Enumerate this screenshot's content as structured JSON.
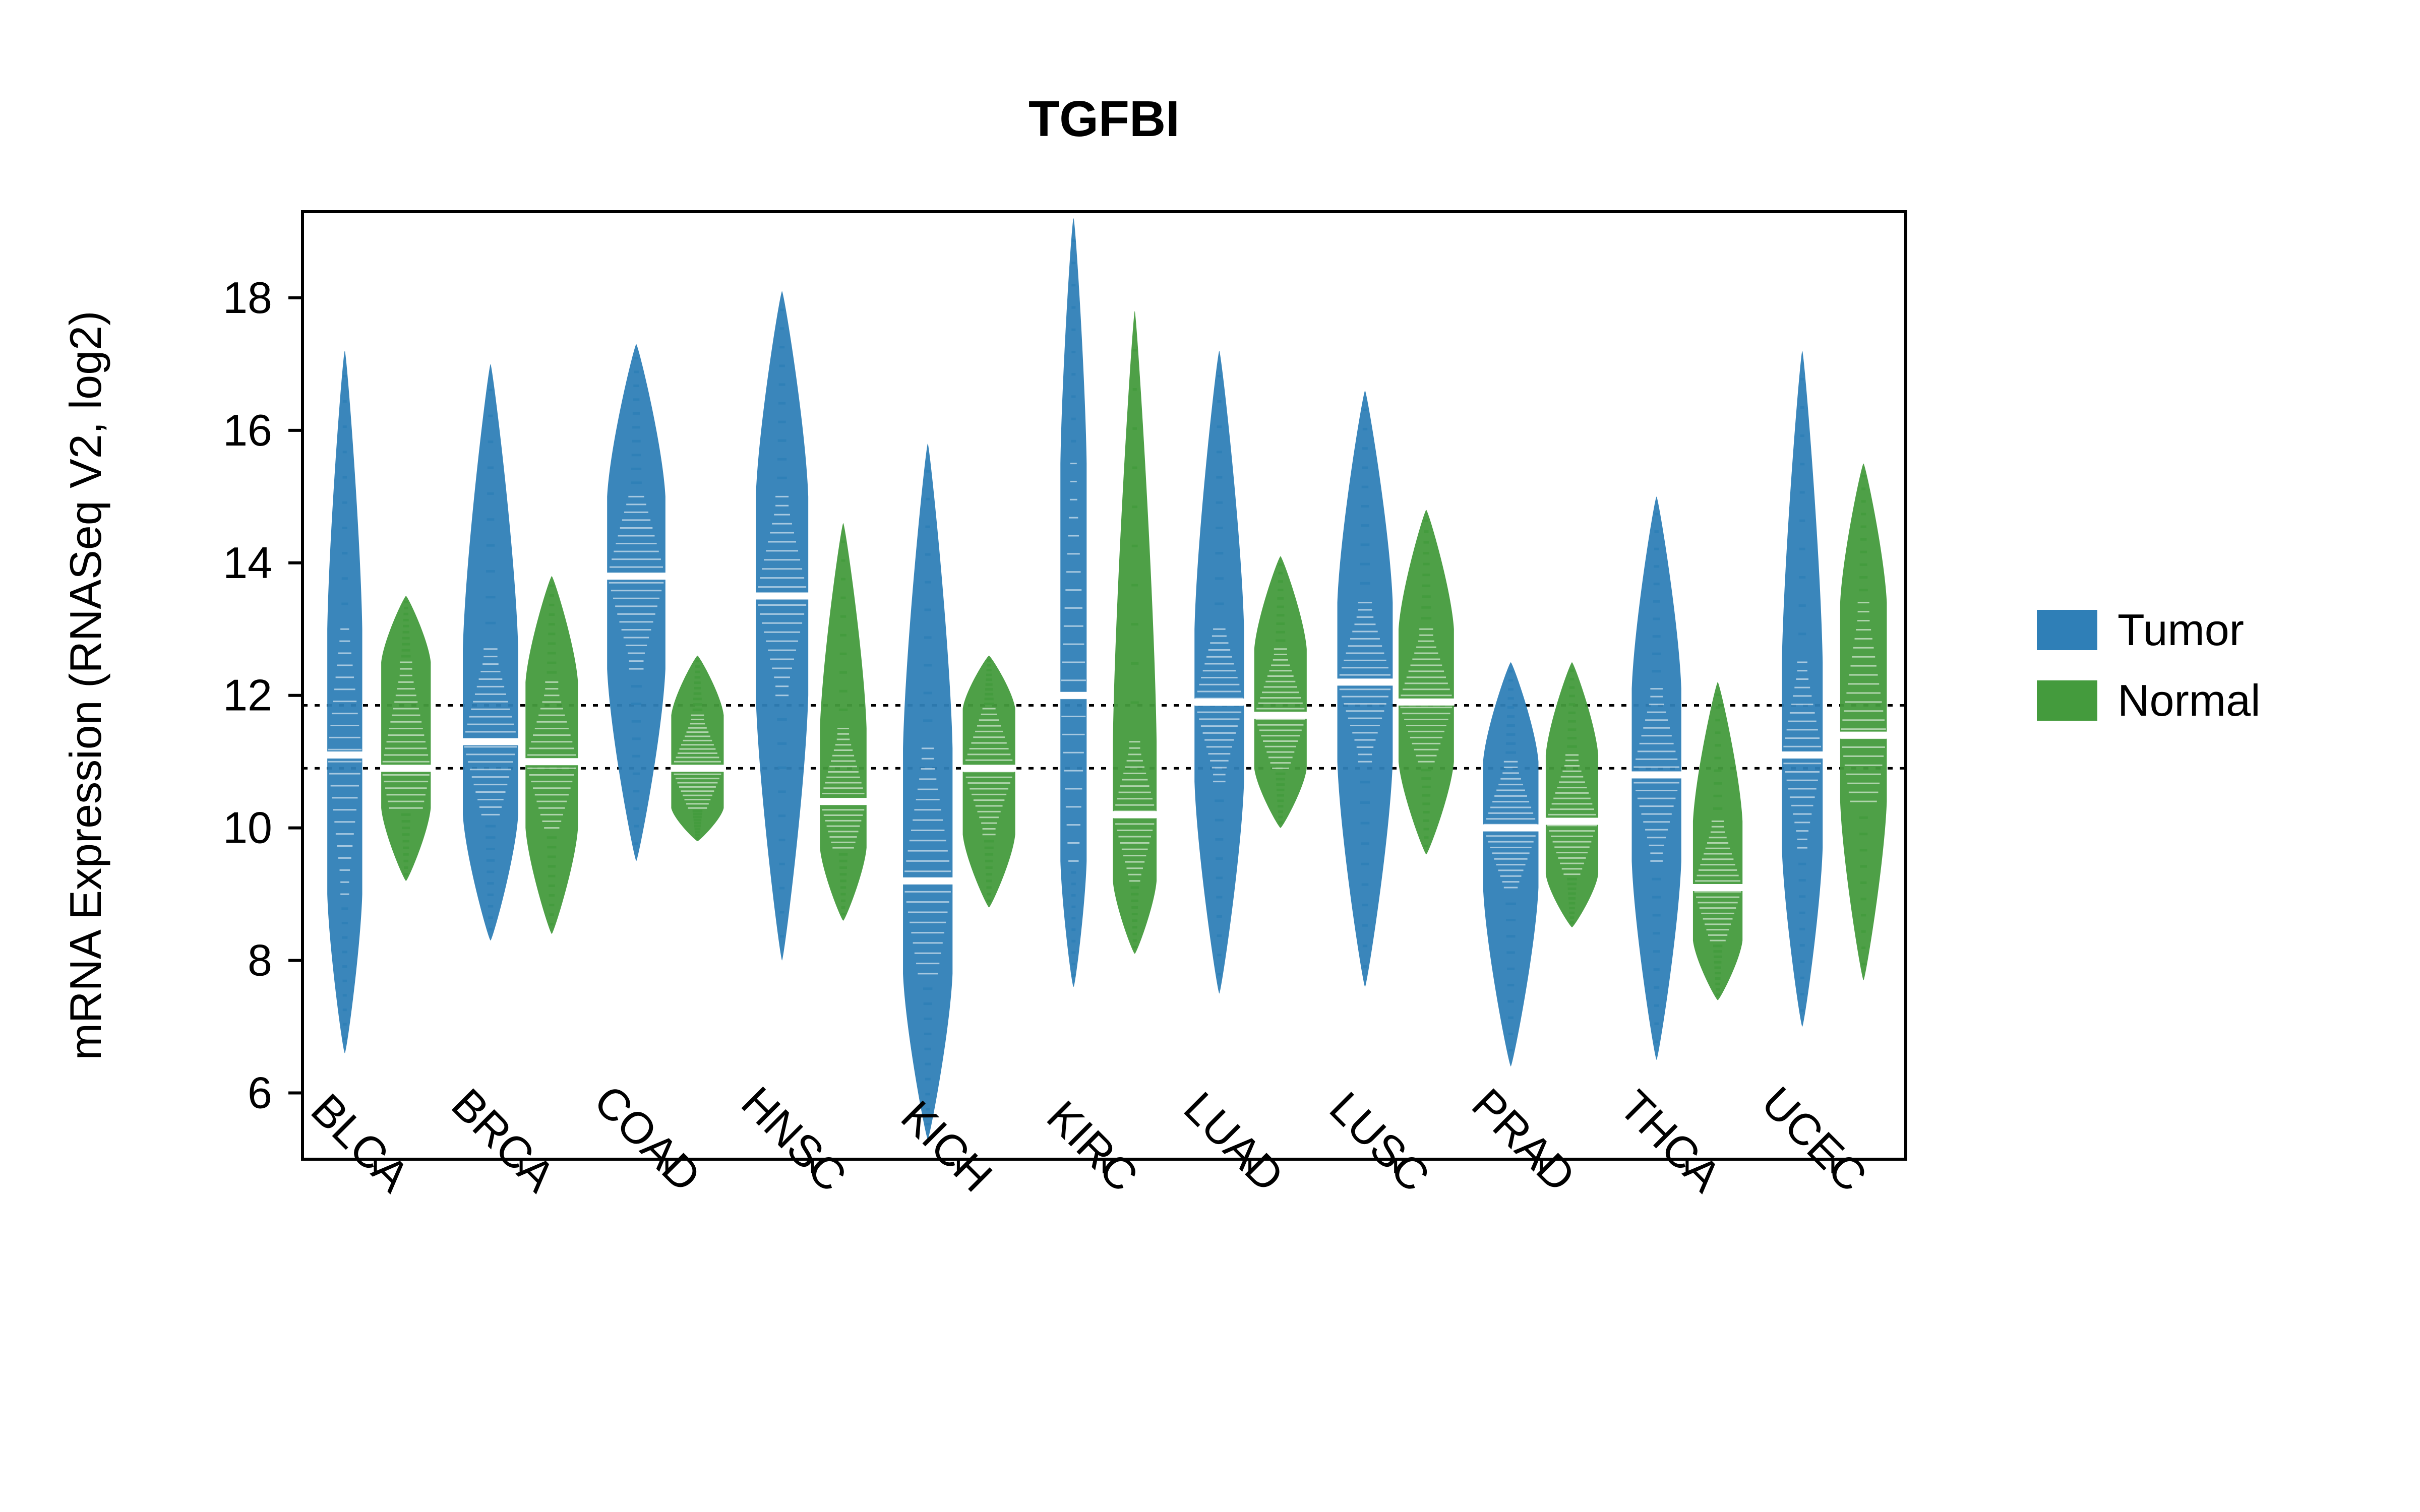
{
  "chart_data": {
    "type": "violin",
    "title": "TGFBI",
    "ylabel": "mRNA Expression (RNASeq V2, log2)",
    "xlabel": "",
    "ylim": [
      5.0,
      19.3
    ],
    "yticks": [
      6,
      8,
      10,
      12,
      14,
      16,
      18
    ],
    "hlines": [
      10.9,
      11.85
    ],
    "categories": [
      "BLCA",
      "BRCA",
      "COAD",
      "HNSC",
      "KICH",
      "KIRC",
      "LUAD",
      "LUSC",
      "PRAD",
      "THCA",
      "UCEC"
    ],
    "colors": {
      "Tumor": "#2F7FB7",
      "Normal": "#449B3D"
    },
    "legend": [
      "Tumor",
      "Normal"
    ],
    "series": [
      {
        "name": "Tumor",
        "color": "#2F7FB7",
        "violins": [
          {
            "cat": "BLCA",
            "median": 11.1,
            "range": [
              6.6,
              17.2
            ],
            "bulk": [
              9.0,
              13.0
            ],
            "peakWidth": 0.6
          },
          {
            "cat": "BRCA",
            "median": 11.3,
            "range": [
              8.3,
              17.0
            ],
            "bulk": [
              10.2,
              12.7
            ],
            "peakWidth": 0.95
          },
          {
            "cat": "COAD",
            "median": 13.8,
            "range": [
              9.5,
              17.3
            ],
            "bulk": [
              12.4,
              15.0
            ],
            "peakWidth": 1.0
          },
          {
            "cat": "HNSC",
            "median": 13.5,
            "range": [
              8.0,
              18.1
            ],
            "bulk": [
              12.0,
              15.0
            ],
            "peakWidth": 0.9
          },
          {
            "cat": "KICH",
            "median": 9.2,
            "range": [
              5.3,
              15.8
            ],
            "bulk": [
              7.8,
              11.2
            ],
            "peakWidth": 0.85
          },
          {
            "cat": "KIRC",
            "median": 12.0,
            "range": [
              7.6,
              19.2
            ],
            "bulk": [
              9.5,
              15.5
            ],
            "peakWidth": 0.45
          },
          {
            "cat": "LUAD",
            "median": 11.9,
            "range": [
              7.5,
              17.2
            ],
            "bulk": [
              10.7,
              13.0
            ],
            "peakWidth": 0.85
          },
          {
            "cat": "LUSC",
            "median": 12.2,
            "range": [
              7.6,
              16.6
            ],
            "bulk": [
              11.0,
              13.4
            ],
            "peakWidth": 0.95
          },
          {
            "cat": "PRAD",
            "median": 10.0,
            "range": [
              6.4,
              12.5
            ],
            "bulk": [
              9.1,
              11.0
            ],
            "peakWidth": 0.95
          },
          {
            "cat": "THCA",
            "median": 10.8,
            "range": [
              6.5,
              15.0
            ],
            "bulk": [
              9.5,
              12.1
            ],
            "peakWidth": 0.85
          },
          {
            "cat": "UCEC",
            "median": 11.1,
            "range": [
              7.0,
              17.2
            ],
            "bulk": [
              9.7,
              12.5
            ],
            "peakWidth": 0.7
          }
        ]
      },
      {
        "name": "Normal",
        "color": "#449B3D",
        "violins": [
          {
            "cat": "BLCA",
            "median": 10.9,
            "range": [
              9.2,
              13.5
            ],
            "bulk": [
              10.3,
              12.5
            ],
            "peakWidth": 0.85
          },
          {
            "cat": "BRCA",
            "median": 11.0,
            "range": [
              8.4,
              13.8
            ],
            "bulk": [
              10.0,
              12.2
            ],
            "peakWidth": 0.9
          },
          {
            "cat": "COAD",
            "median": 10.9,
            "range": [
              9.8,
              12.6
            ],
            "bulk": [
              10.3,
              11.7
            ],
            "peakWidth": 0.9
          },
          {
            "cat": "HNSC",
            "median": 10.4,
            "range": [
              8.6,
              14.6
            ],
            "bulk": [
              9.7,
              11.5
            ],
            "peakWidth": 0.8
          },
          {
            "cat": "KICH",
            "median": 10.9,
            "range": [
              8.8,
              12.6
            ],
            "bulk": [
              9.9,
              11.8
            ],
            "peakWidth": 0.9
          },
          {
            "cat": "KIRC",
            "median": 10.2,
            "range": [
              8.1,
              17.8
            ],
            "bulk": [
              9.2,
              11.3
            ],
            "peakWidth": 0.75
          },
          {
            "cat": "LUAD",
            "median": 11.7,
            "range": [
              10.0,
              14.1
            ],
            "bulk": [
              10.9,
              12.7
            ],
            "peakWidth": 0.9
          },
          {
            "cat": "LUSC",
            "median": 11.9,
            "range": [
              9.6,
              14.8
            ],
            "bulk": [
              11.0,
              13.0
            ],
            "peakWidth": 0.95
          },
          {
            "cat": "PRAD",
            "median": 10.1,
            "range": [
              8.5,
              12.5
            ],
            "bulk": [
              9.3,
              11.1
            ],
            "peakWidth": 0.9
          },
          {
            "cat": "THCA",
            "median": 9.1,
            "range": [
              7.4,
              12.2
            ],
            "bulk": [
              8.3,
              10.1
            ],
            "peakWidth": 0.85
          },
          {
            "cat": "UCEC",
            "median": 11.4,
            "range": [
              7.7,
              15.5
            ],
            "bulk": [
              10.4,
              13.4
            ],
            "peakWidth": 0.8
          }
        ]
      }
    ]
  }
}
